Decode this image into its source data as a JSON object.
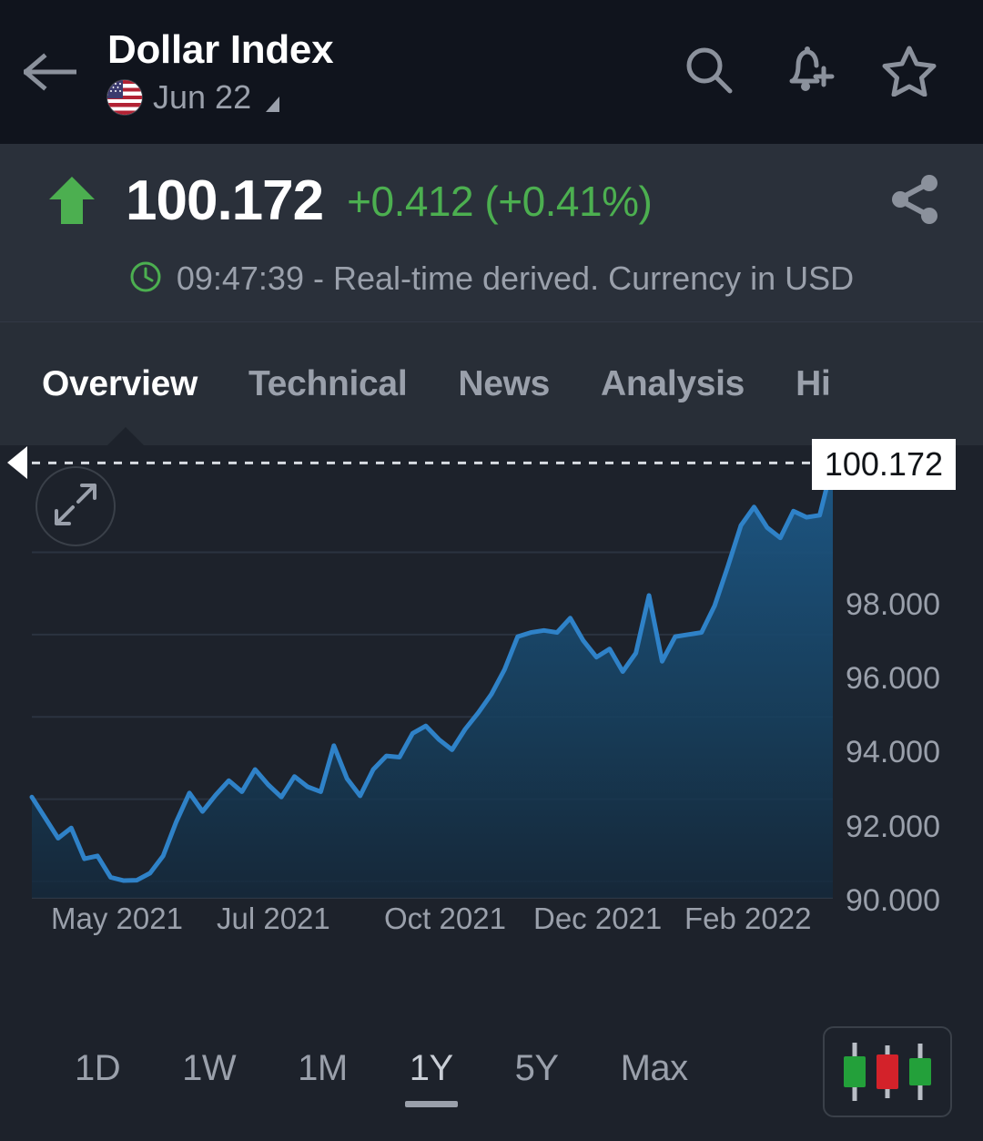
{
  "header": {
    "back_icon": "back-arrow-icon",
    "title": "Dollar Index",
    "subtitle": "Jun 22",
    "flag_icon": "us-flag-icon",
    "dropdown_icon": "dropdown-caret-icon",
    "search_icon": "search-icon",
    "alert_icon": "add-alert-bell-icon",
    "watchlist_icon": "star-icon"
  },
  "quote": {
    "direction_icon": "up-arrow-icon",
    "last_price": "100.172",
    "change": "+0.412 (+0.41%)",
    "change_color": "#4caf50",
    "share_icon": "share-icon",
    "clock_icon": "clock-icon",
    "status_text": "09:47:39 - Real-time derived. Currency in USD"
  },
  "tabs": {
    "items": [
      {
        "label": "Overview",
        "active": true
      },
      {
        "label": "Technical",
        "active": false
      },
      {
        "label": "News",
        "active": false
      },
      {
        "label": "Analysis",
        "active": false
      },
      {
        "label": "Hi",
        "active": false
      }
    ]
  },
  "chart": {
    "expand_icon": "expand-fullscreen-icon",
    "current_price_badge": "100.172",
    "line_color": "#2f82c8",
    "fill_color": "#16364f"
  },
  "ranges": {
    "items": [
      {
        "label": "1D",
        "active": false
      },
      {
        "label": "1W",
        "active": false
      },
      {
        "label": "1M",
        "active": false
      },
      {
        "label": "1Y",
        "active": true
      },
      {
        "label": "5Y",
        "active": false
      },
      {
        "label": "Max",
        "active": false
      }
    ],
    "chart_type_icon": "candlestick-chart-icon"
  },
  "chart_data": {
    "type": "line",
    "title": "Dollar Index",
    "xlabel": "",
    "ylabel": "",
    "ylim": [
      89.6,
      100.6
    ],
    "yticks": [
      90.0,
      92.0,
      94.0,
      96.0,
      98.0
    ],
    "ytick_labels": [
      "90.000",
      "92.000",
      "94.000",
      "96.000",
      "98.000"
    ],
    "xticks": [
      "May 2021",
      "Jul 2021",
      "Oct 2021",
      "Dec 2021",
      "Feb 2022"
    ],
    "xtick_positions": [
      0.055,
      0.27,
      0.49,
      0.67,
      0.855
    ],
    "grid": true,
    "annotations": [
      {
        "label": "100.172",
        "value": 100.172,
        "type": "current-price-dashed-line"
      }
    ],
    "series": [
      {
        "name": "Dollar Index",
        "color": "#2f82c8",
        "values": [
          92.05,
          91.55,
          91.05,
          91.3,
          90.55,
          90.62,
          90.1,
          90.02,
          90.03,
          90.2,
          90.62,
          91.45,
          92.15,
          91.7,
          92.1,
          92.45,
          92.18,
          92.72,
          92.35,
          92.05,
          92.55,
          92.3,
          92.18,
          93.3,
          92.5,
          92.08,
          92.72,
          93.05,
          93.02,
          93.6,
          93.78,
          93.45,
          93.2,
          93.7,
          94.1,
          94.55,
          95.15,
          95.95,
          96.05,
          96.1,
          96.05,
          96.4,
          95.85,
          95.45,
          95.65,
          95.1,
          95.55,
          96.95,
          95.35,
          95.95,
          96.0,
          96.05,
          96.7,
          97.65,
          98.65,
          99.1,
          98.6,
          98.35,
          99.0,
          98.85,
          98.9,
          100.172
        ]
      }
    ]
  }
}
